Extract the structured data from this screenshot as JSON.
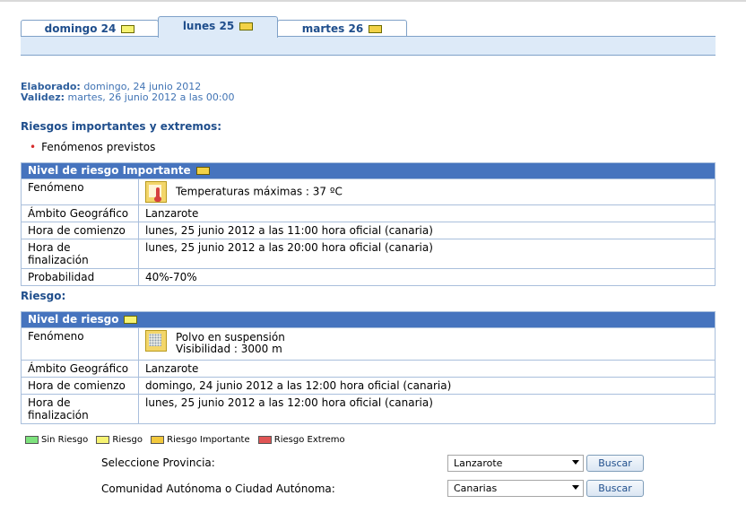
{
  "tabs": [
    {
      "label": "domingo 24",
      "color": "#f6f372"
    },
    {
      "label": "lunes 25",
      "color": "#f2d247"
    },
    {
      "label": "martes 26",
      "color": "#f6f372"
    }
  ],
  "meta": {
    "elaborado_label": "Elaborado:",
    "elaborado_value": "domingo, 24 junio 2012",
    "validez_label": "Validez:",
    "validez_value": "martes, 26 junio 2012 a las 00:00"
  },
  "important": {
    "title": "Riesgos importantes y extremos:",
    "bullet": "Fenómenos previstos",
    "header": "Nivel de riesgo Importante",
    "header_color": "#f2d247",
    "rows": {
      "fenomeno_label": "Fenómeno",
      "fenomeno_value": "Temperaturas máximas : 37 ºC",
      "fenomeno_icon": "thermometer-icon",
      "ambito_label": "Ámbito Geográfico",
      "ambito_value": "Lanzarote",
      "comienzo_label": "Hora de comienzo",
      "comienzo_value": "lunes, 25 junio 2012 a las 11:00 hora oficial (canaria)",
      "fin_label": "Hora de finalización",
      "fin_value": "lunes, 25 junio 2012 a las 20:00 hora oficial (canaria)",
      "prob_label": "Probabilidad",
      "prob_value": "40%-70%"
    }
  },
  "risk": {
    "title": "Riesgo:",
    "header": "Nivel de riesgo",
    "header_color": "#f6f372",
    "rows": {
      "fenomeno_label": "Fenómeno",
      "fenomeno_line1": "Polvo en suspensión",
      "fenomeno_line2": "Visibilidad : 3000 m",
      "fenomeno_icon": "dust-icon",
      "ambito_label": "Ámbito Geográfico",
      "ambito_value": "Lanzarote",
      "comienzo_label": "Hora de comienzo",
      "comienzo_value": "domingo, 24 junio 2012 a las 12:00 hora oficial (canaria)",
      "fin_label": "Hora de finalización",
      "fin_value": "lunes, 25 junio 2012 a las 12:00 hora oficial (canaria)"
    }
  },
  "legend": [
    {
      "label": "Sin Riesgo",
      "color": "#7de27d"
    },
    {
      "label": "Riesgo",
      "color": "#f6f372"
    },
    {
      "label": "Riesgo Importante",
      "color": "#f2c83c"
    },
    {
      "label": "Riesgo Extremo",
      "color": "#e05555"
    }
  ],
  "filters": {
    "provincia_label": "Seleccione Provincia:",
    "provincia_value": "Lanzarote",
    "comunidad_label": "Comunidad Autónoma o Ciudad Autónoma:",
    "comunidad_value": "Canarias",
    "buscar_label": "Buscar"
  }
}
